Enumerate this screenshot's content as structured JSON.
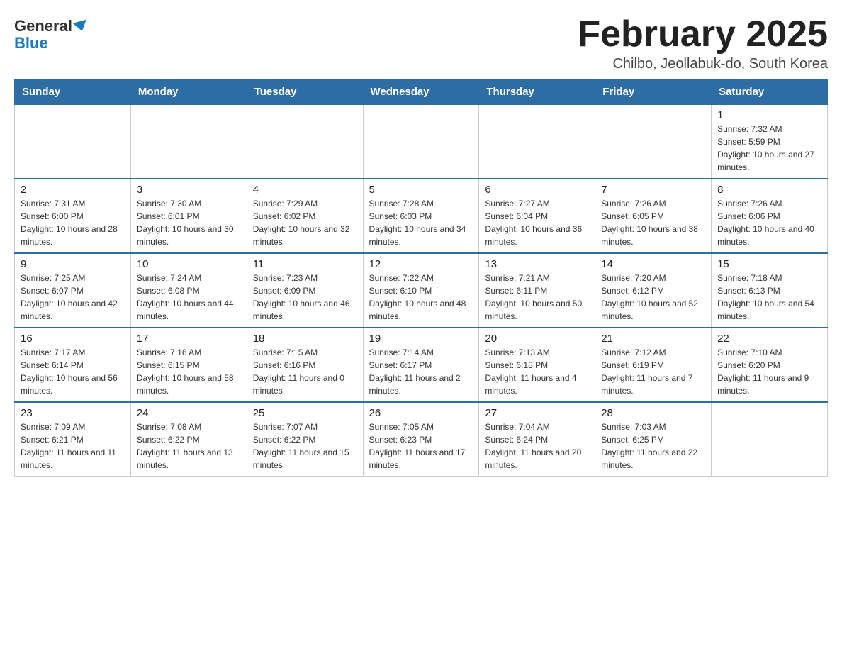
{
  "logo": {
    "general": "General",
    "blue": "Blue"
  },
  "title": "February 2025",
  "subtitle": "Chilbo, Jeollabuk-do, South Korea",
  "weekdays": [
    "Sunday",
    "Monday",
    "Tuesday",
    "Wednesday",
    "Thursday",
    "Friday",
    "Saturday"
  ],
  "weeks": [
    [
      {
        "day": "",
        "info": ""
      },
      {
        "day": "",
        "info": ""
      },
      {
        "day": "",
        "info": ""
      },
      {
        "day": "",
        "info": ""
      },
      {
        "day": "",
        "info": ""
      },
      {
        "day": "",
        "info": ""
      },
      {
        "day": "1",
        "info": "Sunrise: 7:32 AM\nSunset: 5:59 PM\nDaylight: 10 hours and 27 minutes."
      }
    ],
    [
      {
        "day": "2",
        "info": "Sunrise: 7:31 AM\nSunset: 6:00 PM\nDaylight: 10 hours and 28 minutes."
      },
      {
        "day": "3",
        "info": "Sunrise: 7:30 AM\nSunset: 6:01 PM\nDaylight: 10 hours and 30 minutes."
      },
      {
        "day": "4",
        "info": "Sunrise: 7:29 AM\nSunset: 6:02 PM\nDaylight: 10 hours and 32 minutes."
      },
      {
        "day": "5",
        "info": "Sunrise: 7:28 AM\nSunset: 6:03 PM\nDaylight: 10 hours and 34 minutes."
      },
      {
        "day": "6",
        "info": "Sunrise: 7:27 AM\nSunset: 6:04 PM\nDaylight: 10 hours and 36 minutes."
      },
      {
        "day": "7",
        "info": "Sunrise: 7:26 AM\nSunset: 6:05 PM\nDaylight: 10 hours and 38 minutes."
      },
      {
        "day": "8",
        "info": "Sunrise: 7:26 AM\nSunset: 6:06 PM\nDaylight: 10 hours and 40 minutes."
      }
    ],
    [
      {
        "day": "9",
        "info": "Sunrise: 7:25 AM\nSunset: 6:07 PM\nDaylight: 10 hours and 42 minutes."
      },
      {
        "day": "10",
        "info": "Sunrise: 7:24 AM\nSunset: 6:08 PM\nDaylight: 10 hours and 44 minutes."
      },
      {
        "day": "11",
        "info": "Sunrise: 7:23 AM\nSunset: 6:09 PM\nDaylight: 10 hours and 46 minutes."
      },
      {
        "day": "12",
        "info": "Sunrise: 7:22 AM\nSunset: 6:10 PM\nDaylight: 10 hours and 48 minutes."
      },
      {
        "day": "13",
        "info": "Sunrise: 7:21 AM\nSunset: 6:11 PM\nDaylight: 10 hours and 50 minutes."
      },
      {
        "day": "14",
        "info": "Sunrise: 7:20 AM\nSunset: 6:12 PM\nDaylight: 10 hours and 52 minutes."
      },
      {
        "day": "15",
        "info": "Sunrise: 7:18 AM\nSunset: 6:13 PM\nDaylight: 10 hours and 54 minutes."
      }
    ],
    [
      {
        "day": "16",
        "info": "Sunrise: 7:17 AM\nSunset: 6:14 PM\nDaylight: 10 hours and 56 minutes."
      },
      {
        "day": "17",
        "info": "Sunrise: 7:16 AM\nSunset: 6:15 PM\nDaylight: 10 hours and 58 minutes."
      },
      {
        "day": "18",
        "info": "Sunrise: 7:15 AM\nSunset: 6:16 PM\nDaylight: 11 hours and 0 minutes."
      },
      {
        "day": "19",
        "info": "Sunrise: 7:14 AM\nSunset: 6:17 PM\nDaylight: 11 hours and 2 minutes."
      },
      {
        "day": "20",
        "info": "Sunrise: 7:13 AM\nSunset: 6:18 PM\nDaylight: 11 hours and 4 minutes."
      },
      {
        "day": "21",
        "info": "Sunrise: 7:12 AM\nSunset: 6:19 PM\nDaylight: 11 hours and 7 minutes."
      },
      {
        "day": "22",
        "info": "Sunrise: 7:10 AM\nSunset: 6:20 PM\nDaylight: 11 hours and 9 minutes."
      }
    ],
    [
      {
        "day": "23",
        "info": "Sunrise: 7:09 AM\nSunset: 6:21 PM\nDaylight: 11 hours and 11 minutes."
      },
      {
        "day": "24",
        "info": "Sunrise: 7:08 AM\nSunset: 6:22 PM\nDaylight: 11 hours and 13 minutes."
      },
      {
        "day": "25",
        "info": "Sunrise: 7:07 AM\nSunset: 6:22 PM\nDaylight: 11 hours and 15 minutes."
      },
      {
        "day": "26",
        "info": "Sunrise: 7:05 AM\nSunset: 6:23 PM\nDaylight: 11 hours and 17 minutes."
      },
      {
        "day": "27",
        "info": "Sunrise: 7:04 AM\nSunset: 6:24 PM\nDaylight: 11 hours and 20 minutes."
      },
      {
        "day": "28",
        "info": "Sunrise: 7:03 AM\nSunset: 6:25 PM\nDaylight: 11 hours and 22 minutes."
      },
      {
        "day": "",
        "info": ""
      }
    ]
  ]
}
